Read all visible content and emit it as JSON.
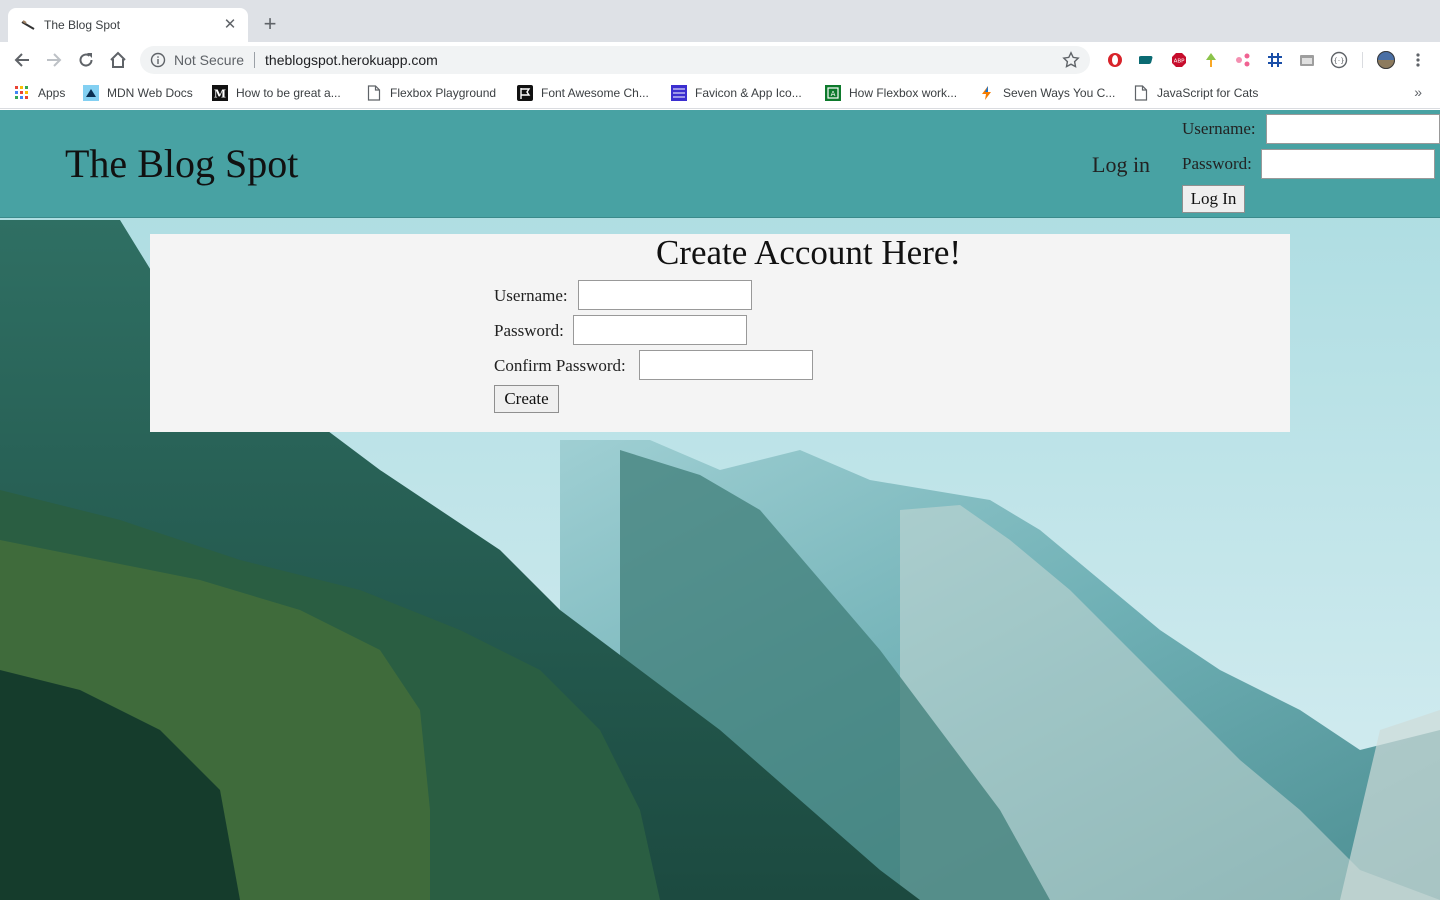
{
  "browser": {
    "tab_title": "The Blog Spot",
    "security_label": "Not Secure",
    "url": "theblogspot.herokuapp.com"
  },
  "bookmarks": [
    {
      "label": "Apps",
      "icon": "apps-grid-icon"
    },
    {
      "label": "MDN Web Docs",
      "icon": "mdn-icon"
    },
    {
      "label": "How to be great a...",
      "icon": "medium-icon"
    },
    {
      "label": "Flexbox Playground",
      "icon": "page-icon"
    },
    {
      "label": "Font Awesome Ch...",
      "icon": "flag-icon"
    },
    {
      "label": "Favicon & App Ico...",
      "icon": "favicon-icon"
    },
    {
      "label": "How Flexbox work...",
      "icon": "flexbox-icon"
    },
    {
      "label": "Seven Ways You C...",
      "icon": "bolt-icon"
    },
    {
      "label": "JavaScript for Cats",
      "icon": "page-icon"
    }
  ],
  "header": {
    "site_title": "The Blog Spot",
    "login_link": "Log in",
    "username_label": "Username:",
    "password_label": "Password:",
    "login_button": "Log In"
  },
  "signup": {
    "title": "Create Account Here!",
    "username_label": "Username:",
    "password_label": "Password:",
    "confirm_label": "Confirm Password:",
    "create_button": "Create"
  },
  "colors": {
    "header_bg": "#48a2a3",
    "card_bg": "#f4f4f4"
  }
}
